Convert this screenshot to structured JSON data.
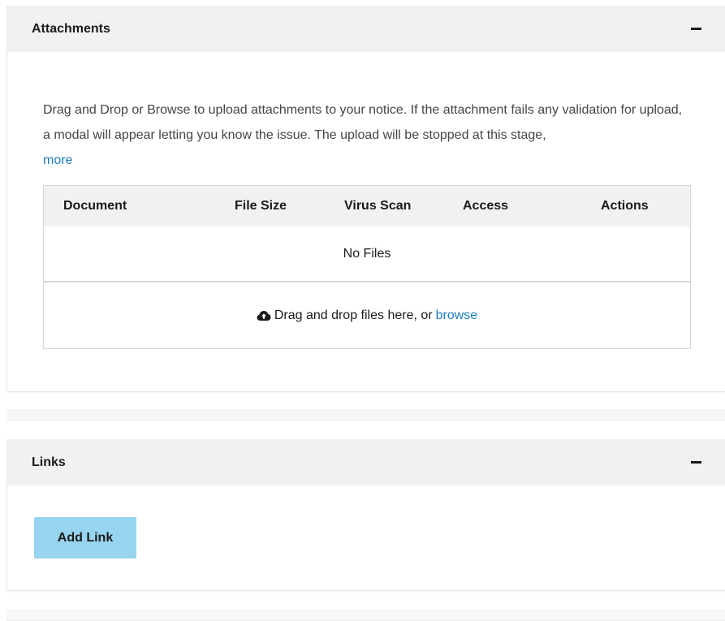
{
  "attachments": {
    "title": "Attachments",
    "collapse_icon": "minus-icon",
    "description_text": "Drag and Drop or Browse to upload attachments to your notice. If the attachment fails any validation for upload, a modal will appear letting you know the issue. The upload will be stopped at this stage, ",
    "more_link": "more",
    "table": {
      "columns": [
        "Document",
        "File Size",
        "Virus Scan",
        "Access",
        "Actions"
      ],
      "empty_text": "No Files"
    },
    "dropzone": {
      "icon": "cloud-upload-icon",
      "text": "Drag and drop files here, or",
      "browse_link": "browse"
    }
  },
  "links": {
    "title": "Links",
    "collapse_icon": "minus-icon",
    "add_button": "Add Link"
  },
  "colors": {
    "header_bg": "#f1f1f1",
    "link": "#1a7ec2",
    "button_bg": "#97d4ef",
    "text": "#1b1b1b"
  }
}
